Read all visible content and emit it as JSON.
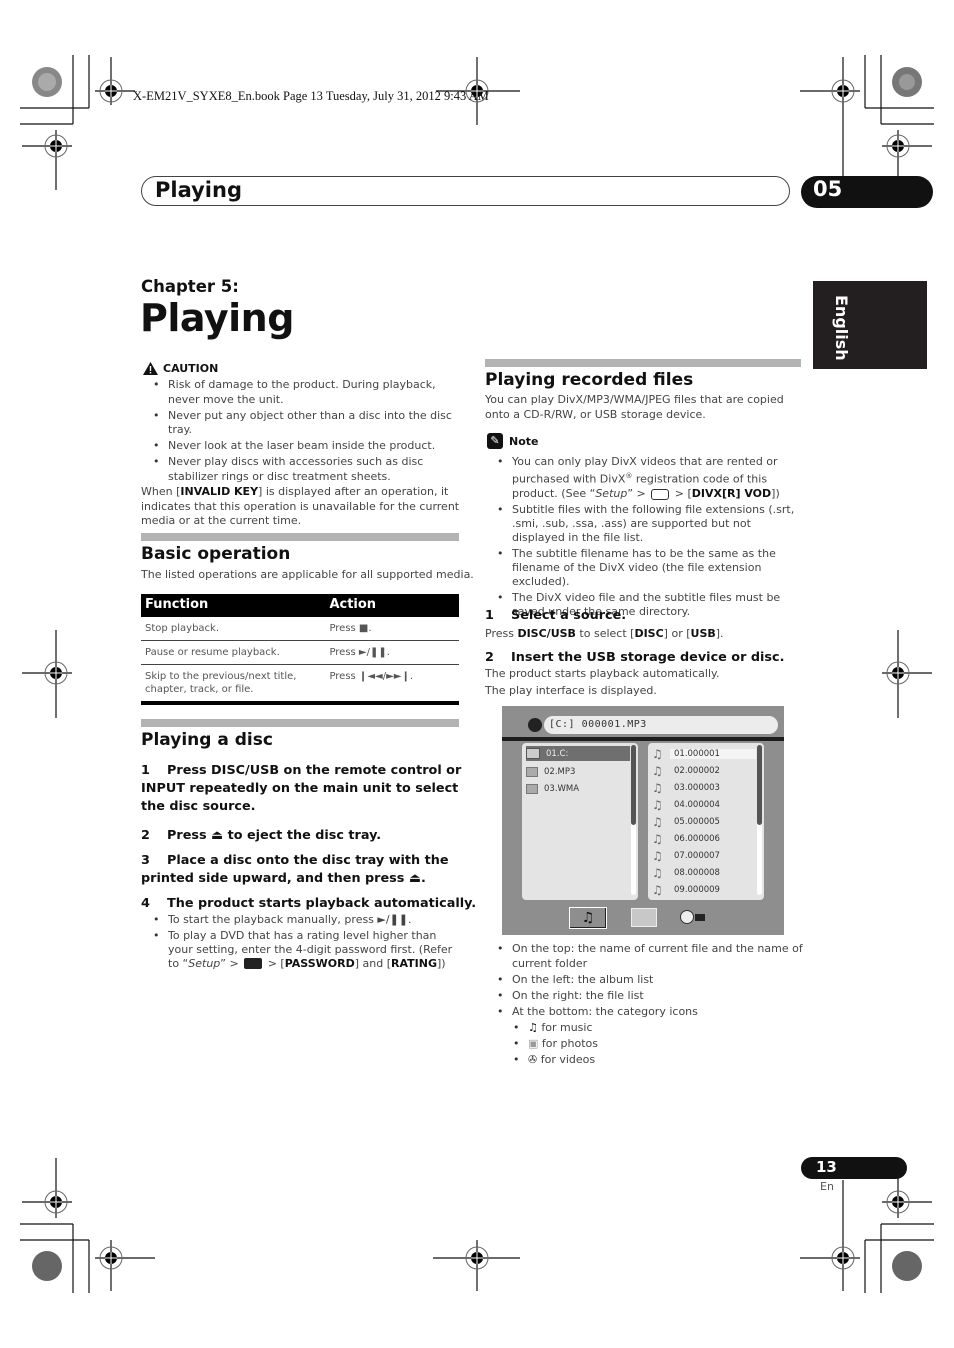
{
  "print_header": "X-EM21V_SYXE8_En.book  Page 13  Tuesday, July 31, 2012  9:43 AM",
  "running_header": {
    "title": "Playing",
    "chapter_number": "05"
  },
  "side_tab": "English",
  "chapter": {
    "label": "Chapter 5:",
    "title": "Playing"
  },
  "caution": {
    "heading": "CAUTION",
    "icon": "warning-triangle-icon",
    "items": [
      "Risk of damage to the product. During playback, never move the unit.",
      "Never put any object other than a disc into the disc tray.",
      "Never look at the laser beam inside the product.",
      "Never play discs with accessories such as disc stabilizer rings or disc treatment sheets."
    ],
    "invalid_pre": "When [",
    "invalid_key": "INVALID KEY",
    "invalid_post": "] is displayed after an operation, it indicates that this operation is unavailable for the current media or at the current time."
  },
  "basic_operation": {
    "title": "Basic operation",
    "intro": "The listed operations are applicable for all supported media.",
    "columns": [
      "Function",
      "Action"
    ],
    "rows": [
      {
        "function": "Stop playback.",
        "action": "Press ■."
      },
      {
        "function": "Pause or resume playback.",
        "action": "Press ►/❚❚."
      },
      {
        "function": "Skip to the previous/next title, chapter, track, or file.",
        "action": "Press ❙◄◄/►►❙."
      }
    ]
  },
  "playing_disc": {
    "title": "Playing a disc",
    "steps": [
      {
        "n": "1",
        "text": "Press DISC/USB on the remote control or INPUT repeatedly on the main unit to select the disc source."
      },
      {
        "n": "2",
        "text": "Press ⏏ to eject the disc tray."
      },
      {
        "n": "3",
        "text": "Place a disc onto the disc tray with the printed side upward, and then press ⏏."
      },
      {
        "n": "4",
        "text": "The product starts playback automatically."
      }
    ],
    "notes": [
      "To start the playback manually, press ►/❚❚.",
      "To play a DVD that has a rating level higher than your setting, enter the 4-digit password first. (Refer to “"
    ],
    "note2_setup": "Setup",
    "note2_mid": "” > ",
    "note2_after_icon": " > [",
    "note2_password": "PASSWORD",
    "note2_and": "] and [",
    "note2_rating": "RATING",
    "note2_end": "])"
  },
  "recorded_files": {
    "title": "Playing recorded files",
    "intro": "You can play DivX/MP3/WMA/JPEG files that are copied onto a CD-R/RW, or USB storage device.",
    "note_heading": "Note",
    "note1_a": "You can only play DivX videos that are rented or purchased with DivX",
    "note1_reg": "®",
    "note1_b": " registration code of this product. (See “",
    "note1_setup": "Setup",
    "note1_c": "” > ",
    "note1_d": " > [",
    "note1_key": "DIVX[R] VOD",
    "note1_e": "])",
    "notes": [
      "Subtitle files with the following file extensions (.srt, .smi, .sub, .ssa, .ass) are supported but not displayed in the file list.",
      "The subtitle filename has to be the same as the filename of the DivX video (the file extension excluded).",
      "The DivX video file and the subtitle files must be saved under the same directory."
    ],
    "step1": {
      "n": "1",
      "title": "Select a source.",
      "pre": "Press ",
      "btn": "DISC/USB",
      "mid": " to select [",
      "disc": "DISC",
      "or": "] or [",
      "usb": "USB",
      "end": "]."
    },
    "step2": {
      "n": "2",
      "title": "Insert the USB storage device or disc.",
      "line1": "The product starts playback automatically.",
      "line2": "The play interface is displayed."
    },
    "screen": {
      "path": "[C:]  000001.MP3",
      "albums": [
        {
          "name": "01.C:",
          "selected": true
        },
        {
          "name": "02.MP3"
        },
        {
          "name": "03.WMA"
        }
      ],
      "files": [
        "01.000001",
        "02.000002",
        "03.000003",
        "04.000004",
        "05.000005",
        "06.000006",
        "07.000007",
        "08.000008",
        "09.000009"
      ],
      "selected_file_index": 0,
      "categories": [
        "music",
        "photos",
        "videos"
      ],
      "active_category": "music"
    },
    "legend": [
      "On the top: the name of current file and the name of current folder",
      "On the left: the album list",
      "On the right: the file list",
      "At the bottom: the category icons"
    ],
    "category_legend": [
      {
        "icon": "music-note-icon",
        "glyph": "♫",
        "text": " for music"
      },
      {
        "icon": "photos-icon",
        "glyph": "▣",
        "text": " for photos"
      },
      {
        "icon": "video-reel-icon",
        "glyph": "✇",
        "text": " for videos"
      }
    ]
  },
  "footer": {
    "page_number": "13",
    "lang": "En"
  }
}
